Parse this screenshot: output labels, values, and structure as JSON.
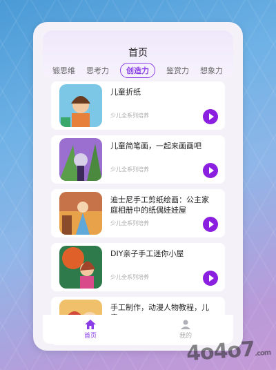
{
  "header": {
    "title": "首页"
  },
  "tabs": [
    {
      "label": "锻思维",
      "active": false
    },
    {
      "label": "思考力",
      "active": false
    },
    {
      "label": "创造力",
      "active": true
    },
    {
      "label": "鉴赏力",
      "active": false
    },
    {
      "label": "想象力",
      "active": false
    }
  ],
  "cards": [
    {
      "title": "儿童折纸",
      "subtitle": "少儿全系列培养"
    },
    {
      "title": "儿童简笔画，一起来画画吧",
      "subtitle": "少儿全系列培养"
    },
    {
      "title": "迪士尼手工剪纸绘画：公主家庭相册中的纸偶娃娃屋",
      "subtitle": "少儿全系列培养"
    },
    {
      "title": "DIY亲子手工迷你小屋",
      "subtitle": "少儿全系列培养"
    },
    {
      "title": "手工制作，动漫人物教程，儿童",
      "subtitle": ""
    }
  ],
  "nav": [
    {
      "label": "首页",
      "icon": "home-icon",
      "active": true
    },
    {
      "label": "我的",
      "icon": "user-icon",
      "active": false
    }
  ],
  "watermark": {
    "text": "4o4o7",
    "suffix": ".com"
  },
  "colors": {
    "accent": "#8b3ee6",
    "play": "#8b1fe0"
  }
}
